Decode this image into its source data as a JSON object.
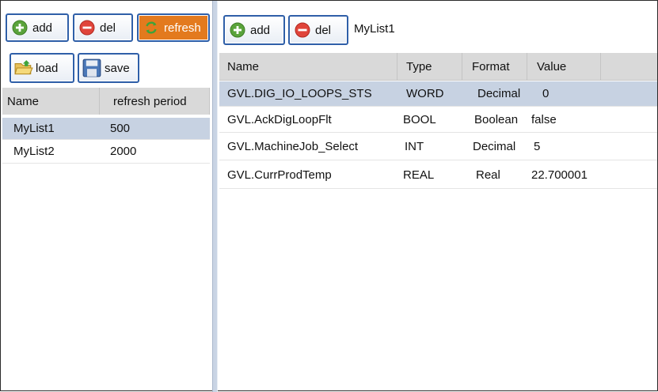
{
  "left": {
    "buttons": {
      "add": "add",
      "del": "del",
      "refresh": "refresh",
      "load": "load",
      "save": "save"
    },
    "columns": {
      "name": "Name",
      "refresh_period": "refresh period"
    },
    "rows": [
      {
        "name": "MyList1",
        "period": "500"
      },
      {
        "name": "MyList2",
        "period": "2000"
      }
    ]
  },
  "right": {
    "buttons": {
      "add": "add",
      "del": "del"
    },
    "list_title": "MyList1",
    "columns": {
      "name": "Name",
      "type": "Type",
      "format": "Format",
      "value": "Value"
    },
    "rows": [
      {
        "name": "GVL.DIG_IO_LOOPS_STS",
        "type": "WORD",
        "format": "Decimal",
        "value": "0"
      },
      {
        "name": "GVL.AckDigLoopFlt",
        "type": "BOOL",
        "format": "Boolean",
        "value": "false"
      },
      {
        "name": "GVL.MachineJob_Select",
        "type": "INT",
        "format": "Decimal",
        "value": "5"
      },
      {
        "name": "GVL.CurrProdTemp",
        "type": "REAL",
        "format": "Real",
        "value": "22.700001"
      }
    ]
  },
  "colors": {
    "selection": "#c7d2e2",
    "header": "#d9d9d9",
    "refresh_button": "#e37a1e",
    "button_border": "#2f5fa8"
  },
  "icons": {
    "add": "plus-circle-icon",
    "del": "minus-circle-icon",
    "refresh": "refresh-icon",
    "load": "open-folder-icon",
    "save": "floppy-disk-icon"
  }
}
